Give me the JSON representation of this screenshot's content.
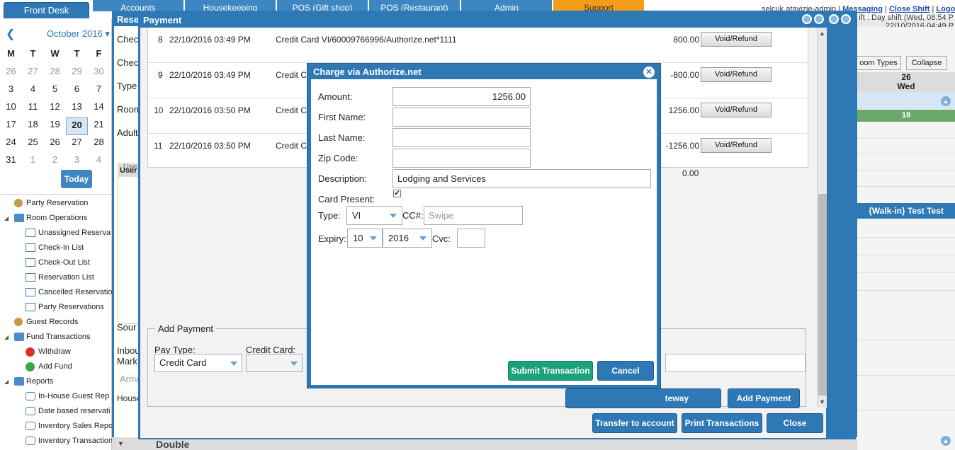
{
  "topbar": {
    "front_desk": "Front Desk",
    "tabs": [
      {
        "label": "Accounts"
      },
      {
        "label": "Housekeeping"
      },
      {
        "label": "POS (Gift shop)"
      },
      {
        "label": "POS (Restaurant)"
      },
      {
        "label": "Admin"
      },
      {
        "label": "Support"
      }
    ],
    "user": "selcuk.atavizie-admin",
    "messaging": "Messaging",
    "close_shift": "Close Shift",
    "logout": "Logo",
    "shift_line1": "ift : Day shift (Wed, 08:54 P",
    "shift_line2": "22/10/2016 04:49 P"
  },
  "calendar": {
    "title": "October 2016",
    "prev": "❮",
    "dropdown": "▾",
    "dow": [
      "M",
      "T",
      "W",
      "T",
      "F"
    ],
    "weeks": [
      [
        "26",
        "27",
        "28",
        "29",
        "30"
      ],
      [
        "3",
        "4",
        "5",
        "6",
        "7"
      ],
      [
        "10",
        "11",
        "12",
        "13",
        "14"
      ],
      [
        "17",
        "18",
        "19",
        "20",
        "21"
      ],
      [
        "24",
        "25",
        "26",
        "27",
        "28"
      ],
      [
        "31",
        "1",
        "2",
        "3",
        "4"
      ]
    ],
    "today_label": "Today"
  },
  "tree": [
    {
      "label": "Party Reservation",
      "icon": "party-icon"
    },
    {
      "label": "Room Operations",
      "icon": "folder-icon"
    },
    {
      "label": "Unassigned Reserva",
      "icon": "list-icon"
    },
    {
      "label": "Check-In List",
      "icon": "list-icon"
    },
    {
      "label": "Check-Out List",
      "icon": "list-icon"
    },
    {
      "label": "Reservation List",
      "icon": "list-icon"
    },
    {
      "label": "Cancelled Reservatio",
      "icon": "list-icon"
    },
    {
      "label": "Party Reservations",
      "icon": "list-icon"
    },
    {
      "label": "Guest Records",
      "icon": "person-icon"
    },
    {
      "label": "Fund Transactions",
      "icon": "folder-icon"
    },
    {
      "label": "Withdraw",
      "icon": "minus-icon"
    },
    {
      "label": "Add Fund",
      "icon": "plus-icon"
    },
    {
      "label": "Reports",
      "icon": "folder-icon"
    },
    {
      "label": "In-House Guest Rep",
      "icon": "print-icon"
    },
    {
      "label": "Date based reservati",
      "icon": "print-icon"
    },
    {
      "label": "Inventory Sales Repo",
      "icon": "print-icon"
    },
    {
      "label": "Inventory Transaction Detail",
      "icon": "print-icon"
    }
  ],
  "right_panel": {
    "room_types": "oom Types",
    "collapse": "Collapse",
    "day_num": "26",
    "day_name": "Wed",
    "count": "18",
    "walkin": "{Walk-in} Test Test"
  },
  "reservation_window": {
    "title": "Rese",
    "labels": [
      "Chec",
      "Chec",
      "Type",
      "Room",
      "Adult",
      "Sour",
      "Inbou",
      "Mark",
      "Arriv",
      "House"
    ],
    "subhead": "User",
    "subrow": "Use",
    "bottom_label": "Double"
  },
  "payment": {
    "title": "Payment",
    "transactions": [
      {
        "num": "8",
        "date": "22/10/2016 03:49 PM",
        "desc": "Credit Card VI/60009766996/Authorize.net*1111",
        "amount": "800.00",
        "action": "Void/Refund"
      },
      {
        "num": "9",
        "date": "22/10/2016 03:49 PM",
        "desc": "Credit Ca",
        "amount": "-800.00",
        "action": "Void/Refund"
      },
      {
        "num": "10",
        "date": "22/10/2016 03:50 PM",
        "desc": "Credit Ca",
        "amount": "1256.00",
        "action": "Void/Refund"
      },
      {
        "num": "11",
        "date": "22/10/2016 03:50 PM",
        "desc": "Credit Ca",
        "amount": "-1256.00",
        "action": "Void/Refund"
      }
    ],
    "balance": "0.00",
    "add_payment": {
      "legend": "Add Payment",
      "pay_type_label": "Pay Type:",
      "pay_type_value": "Credit Card",
      "credit_card_label": "Credit Card:",
      "gateway_button": "teway",
      "add_button": "Add Payment"
    },
    "buttons": {
      "transfer": "Transfer to account",
      "print": "Print Transactions",
      "close": "Close"
    }
  },
  "charge": {
    "title": "Charge via Authorize.net",
    "close_icon": "✕",
    "amount_label": "Amount:",
    "amount_value": "1256.00",
    "first_name_label": "First Name:",
    "first_name_value": "",
    "last_name_label": "Last Name:",
    "last_name_value": "",
    "zip_label": "Zip Code:",
    "zip_value": "",
    "description_label": "Description:",
    "description_value": "Lodging and Services",
    "card_present_label": "Card Present:",
    "card_present_mark": "✔",
    "type_label": "Type:",
    "type_value": "VI",
    "cc_label": "CC#:",
    "cc_placeholder": "Swipe",
    "expiry_label": "Expiry:",
    "expiry_month": "10",
    "expiry_year": "2016",
    "cvc_label": "Cvc:",
    "cvc_value": "",
    "submit": "Submit Transaction",
    "cancel": "Cancel"
  }
}
